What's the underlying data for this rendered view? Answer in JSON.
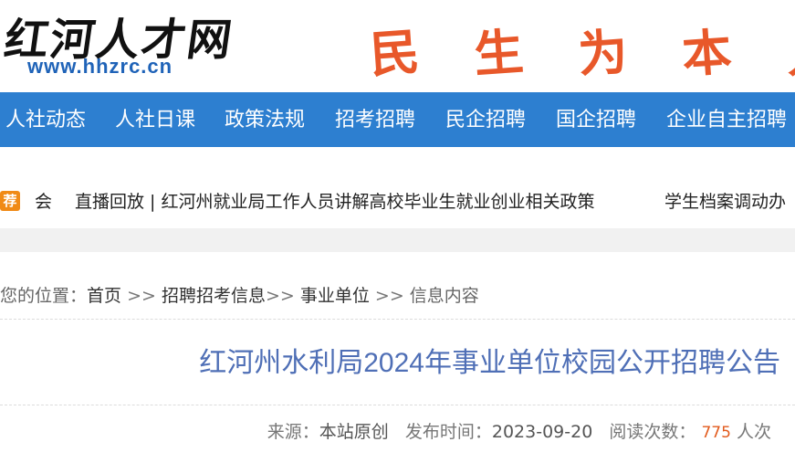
{
  "header": {
    "logo_text": "红河人才网",
    "logo_url": "www.hhzrc.cn",
    "slogan_chars": [
      "民",
      "生",
      "为",
      "本",
      "人"
    ]
  },
  "nav": {
    "items": [
      "人社动态",
      "人社日课",
      "政策法规",
      "招考招聘",
      "民企招聘",
      "国企招聘",
      "企业自主招聘"
    ]
  },
  "ticker": {
    "badge": "荐",
    "items": [
      "会",
      "直播回放 | 红河州就业局工作人员讲解高校毕业生就业创业相关政策",
      "学生档案调动办"
    ]
  },
  "breadcrumb": {
    "prefix": "您的位置：",
    "home": "首页",
    "sep1": " >> ",
    "level1": "招聘招考信息",
    "sep2": ">> ",
    "level2": "事业单位",
    "sep3": " >> ",
    "current": "信息内容"
  },
  "article": {
    "title": "红河州水利局2024年事业单位校园公开招聘公告",
    "source_label": "来源：",
    "source_value": "本站原创",
    "date_label": "发布时间：",
    "date_value": "2023-09-20",
    "views_label": "阅读次数：",
    "views_value": "775",
    "views_unit": "人次"
  },
  "colors": {
    "nav_bg": "#2d7fd0",
    "title": "#4f6fb6",
    "slogan": "#e8582a",
    "badge": "#f08a16",
    "views_count": "#e25a1c"
  }
}
